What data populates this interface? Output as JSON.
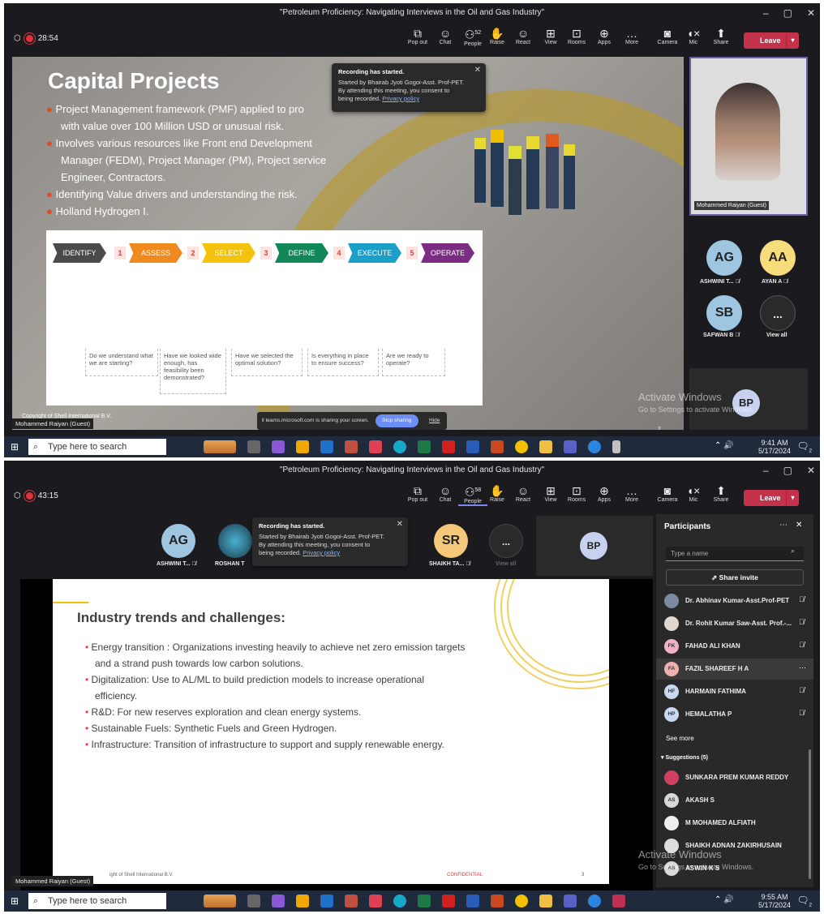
{
  "window_title": "\"Petroleum Proficiency: Navigating Interviews in the Oil and Gas Industry\"",
  "toolbar": {
    "popout": "Pop out",
    "chat": "Chat",
    "people": "People",
    "raise": "Raise",
    "react": "React",
    "view": "View",
    "rooms": "Rooms",
    "apps": "Apps",
    "more": "More",
    "camera": "Camera",
    "mic": "Mic",
    "share": "Share",
    "leave": "Leave"
  },
  "shot1": {
    "timer": "28:54",
    "people_count": "52",
    "slide": {
      "title": "Capital Projects",
      "bullets": [
        "Project Management framework (PMF) applied to pro",
        "with value over 100 Million USD or unusual risk.",
        "Involves various resources like Front end Development",
        "Manager (FEDM), Project Manager (PM), Project service",
        "Engineer, Contractors.",
        "Identifying Value drivers and understanding the risk.",
        "Holland Hydrogen I."
      ],
      "stages": [
        "IDENTIFY",
        "ASSESS",
        "SELECT",
        "DEFINE",
        "EXECUTE",
        "OPERATE"
      ],
      "stage_nums": [
        "1",
        "2",
        "3",
        "4",
        "5"
      ],
      "questions": [
        "Do we understand what we are starting?",
        "Have we looked wide enough, has feasibility been demonstrated?",
        "Have we selected the optimal solution?",
        "Is everything in place to ensure success?",
        "Are we ready to operate?"
      ],
      "copyright": "Copyright of Shell International B.V.",
      "page": "2"
    },
    "presenter_label": "Mohammed Raiyan (Guest)",
    "video_label": "Mohammed Raiyan (Guest)",
    "popup": {
      "title": "Recording has started.",
      "line1": "Started by Bhairab Jyoti Gogoi-Asst. Prof-PET.",
      "line2": "By attending this meeting, you consent to",
      "line3": "being recorded.",
      "link": "Privacy policy"
    },
    "tiles": [
      {
        "initials": "AG",
        "name": "ASHWINI T..."
      },
      {
        "initials": "AA",
        "name": "AYAN A"
      },
      {
        "initials": "SB",
        "name": "SAFWAN B"
      },
      {
        "initials": "...",
        "name": "View all"
      }
    ],
    "self_initials": "BP",
    "share_bar": {
      "text": "teams.microsoft.com is sharing your screen.",
      "stop": "Stop sharing",
      "hide": "Hide"
    },
    "clock_time": "9:41 AM",
    "clock_date": "5/17/2024"
  },
  "shot2": {
    "timer": "43:15",
    "people_count": "58",
    "tiles": [
      {
        "initials": "AG",
        "name": "ASHWINI T..."
      },
      {
        "initials": "",
        "name": "ROSHAN T"
      },
      {
        "initials": "SR",
        "name": "SHAIKH TA..."
      },
      {
        "initials": "...",
        "name": "View all"
      }
    ],
    "self_initials": "BP",
    "popup": {
      "title": "Recording has started.",
      "line1": "Started by Bhairab Jyoti Gogoi-Asst. Prof-PET.",
      "line2": "By attending this meeting, you consent to",
      "line3": "being recorded.",
      "link": "Privacy policy"
    },
    "slide": {
      "title": "Industry trends and challenges:",
      "bullets": [
        "Energy transition : Organizations investing heavily to achieve net zero emission targets",
        "and a strand push towards low carbon solutions.",
        "Digitalization: Use to AL/ML to build prediction models to increase operational",
        "efficiency.",
        "R&D: For new reserves exploration and clean energy systems.",
        "Sustainable Fuels: Synthetic Fuels and Green Hydrogen.",
        "Infrastructure: Transition of infrastructure to support and supply renewable energy."
      ],
      "footer_left": "ight of Shell International B.V.",
      "footer_mid": "CONFIDENTIAL",
      "page": "3"
    },
    "presenter_label": "Mohammed Raiyan (Guest)",
    "panel": {
      "title": "Participants",
      "search_placeholder": "Type a name",
      "share_invite": "Share invite",
      "participants": [
        {
          "initials": "",
          "name": "Dr. Abhinav Kumar-Asst.Prof-PET"
        },
        {
          "initials": "",
          "name": "Dr. Rohit Kumar Saw-Asst. Prof.-..."
        },
        {
          "initials": "FK",
          "name": "FAHAD ALI KHAN"
        },
        {
          "initials": "FA",
          "name": "FAZIL SHAREEF H A"
        },
        {
          "initials": "HF",
          "name": "HARMAIN FATHIMA"
        },
        {
          "initials": "HP",
          "name": "HEMALATHA P"
        }
      ],
      "see_more": "See more",
      "suggestions": "Suggestions (5)",
      "suggested": [
        {
          "initials": "",
          "name": "SUNKARA PREM KUMAR REDDY"
        },
        {
          "initials": "AS",
          "name": "AKASH S"
        },
        {
          "initials": "",
          "name": "M MOHAMED ALFIATH"
        },
        {
          "initials": "",
          "name": "SHAIKH ADNAN ZAKIRHUSAIN"
        },
        {
          "initials": "AS",
          "name": "ASWIN K S"
        }
      ]
    },
    "clock_time": "9:55 AM",
    "clock_date": "5/17/2024"
  },
  "watermark": {
    "line1": "Activate Windows",
    "line2": "Go to Settings to activate Windows."
  },
  "taskbar": {
    "search_placeholder": "Type here to search",
    "notif_count": "2"
  },
  "colors": {
    "identify": "#4a4a4a",
    "assess": "#ef8a1e",
    "select": "#f4c20d",
    "define": "#12875a",
    "execute": "#1a9fc9",
    "operate": "#7b2c83",
    "leave": "#c4314b",
    "num": "#e04040"
  }
}
